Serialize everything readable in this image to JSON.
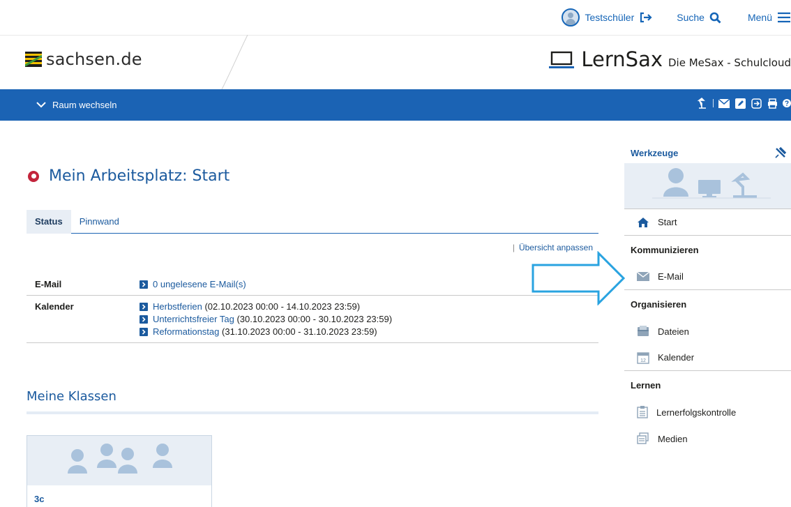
{
  "util": {
    "user_name": "Testschüler",
    "search_label": "Suche",
    "menu_label": "Menü"
  },
  "brand": {
    "state_site": "sachsen.de",
    "product_name": "LernSax",
    "product_subtitle": "Die MeSax - Schulcloud"
  },
  "navbar": {
    "room_switch_label": "Raum wechseln"
  },
  "main": {
    "title": "Mein Arbeitsplatz: Start",
    "tabs": [
      {
        "label": "Status",
        "active": true
      },
      {
        "label": "Pinnwand",
        "active": false
      }
    ],
    "overview_link": "Übersicht anpassen",
    "rows": [
      {
        "label": "E-Mail",
        "items": [
          {
            "link": "0 ungelesene E-Mail(s)",
            "detail": ""
          }
        ]
      },
      {
        "label": "Kalender",
        "items": [
          {
            "link": "Herbstferien",
            "detail": "(02.10.2023 00:00 - 14.10.2023 23:59)"
          },
          {
            "link": "Unterrichtsfreier Tag",
            "detail": "(30.10.2023 00:00 - 30.10.2023 23:59)"
          },
          {
            "link": "Reformationstag",
            "detail": "(31.10.2023 00:00 - 31.10.2023 23:59)"
          }
        ]
      }
    ],
    "classes_title": "Meine Klassen",
    "classes": [
      {
        "name": "3c"
      }
    ]
  },
  "sidebar": {
    "title": "Werkzeuge",
    "start_label": "Start",
    "groups": [
      {
        "label": "Kommunizieren",
        "items": [
          {
            "label": "E-Mail",
            "icon": "envelope-icon"
          }
        ]
      },
      {
        "label": "Organisieren",
        "items": [
          {
            "label": "Dateien",
            "icon": "folder-icon"
          },
          {
            "label": "Kalender",
            "icon": "calendar-icon"
          }
        ]
      },
      {
        "label": "Lernen",
        "items": [
          {
            "label": "Lernerfolgskontrolle",
            "icon": "clipboard-icon"
          },
          {
            "label": "Medien",
            "icon": "media-icon"
          }
        ]
      }
    ]
  },
  "colors": {
    "primary_blue": "#1b63b4",
    "accent_red": "#c3243b",
    "annotation_arrow": "#29a3e0"
  }
}
